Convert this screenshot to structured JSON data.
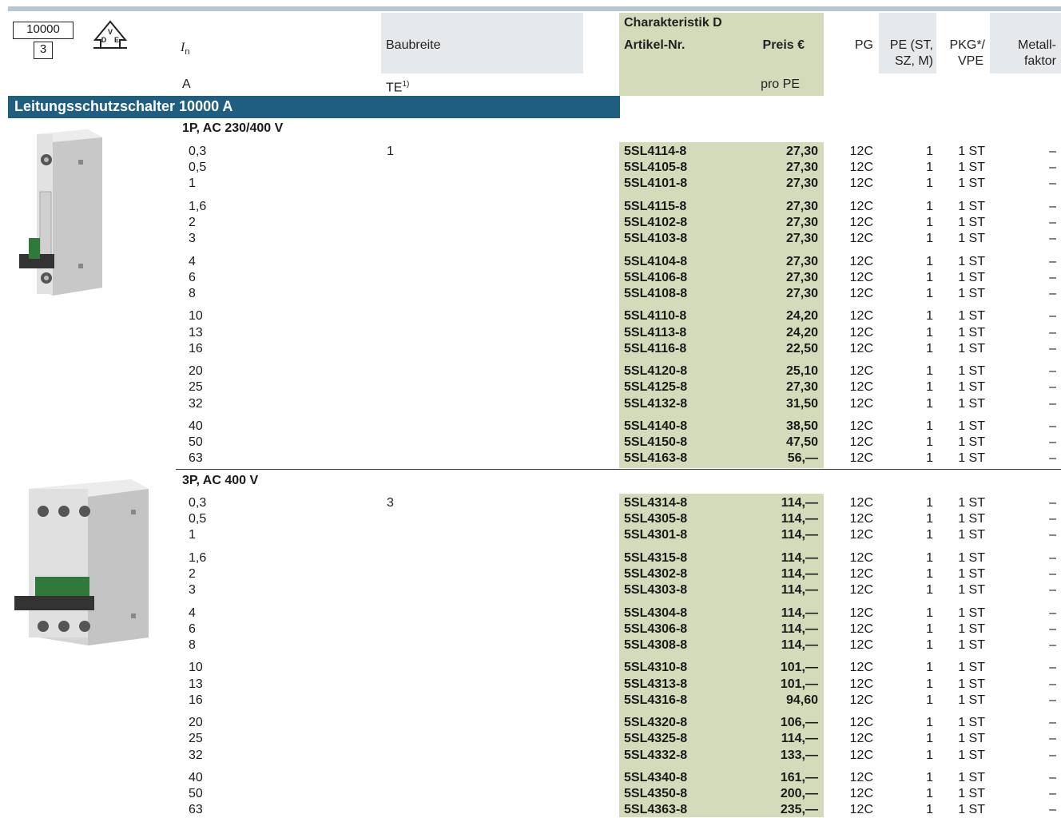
{
  "header": {
    "box_top": "10000",
    "box_bottom": "3",
    "vde_logo": "VDE",
    "col_in_label": "I",
    "col_in_sub": "n",
    "col_in_unit": "A",
    "col_width_label": "Baubreite",
    "col_width_unit": "TE",
    "col_width_sup": "1)",
    "characteristic": "Charakteristik D",
    "col_article": "Artikel-Nr.",
    "col_price": "Preis €",
    "col_price_unit": "pro PE",
    "col_pg": "PG",
    "col_pe_line1": "PE (ST,",
    "col_pe_line2": "SZ, M)",
    "col_pkg_line1": "PKG*/",
    "col_pkg_line2": "VPE",
    "col_mf_line1": "Metall-",
    "col_mf_line2": "faktor"
  },
  "section_title": "Leitungsschutzschalter 10000 A",
  "groups": [
    {
      "title": "1P, AC 230/400 V",
      "image_icon": "breaker-1p-icon",
      "te": "1",
      "rows": [
        {
          "in": "0,3",
          "art": "5SL4114-8",
          "price": "27,30",
          "pg": "12C",
          "pe": "1",
          "pkg": "1 ST",
          "mf": "–"
        },
        {
          "in": "0,5",
          "art": "5SL4105-8",
          "price": "27,30",
          "pg": "12C",
          "pe": "1",
          "pkg": "1 ST",
          "mf": "–"
        },
        {
          "in": "1",
          "art": "5SL4101-8",
          "price": "27,30",
          "pg": "12C",
          "pe": "1",
          "pkg": "1 ST",
          "mf": "–"
        },
        {
          "in": "1,6",
          "art": "5SL4115-8",
          "price": "27,30",
          "pg": "12C",
          "pe": "1",
          "pkg": "1 ST",
          "mf": "–"
        },
        {
          "in": "2",
          "art": "5SL4102-8",
          "price": "27,30",
          "pg": "12C",
          "pe": "1",
          "pkg": "1 ST",
          "mf": "–"
        },
        {
          "in": "3",
          "art": "5SL4103-8",
          "price": "27,30",
          "pg": "12C",
          "pe": "1",
          "pkg": "1 ST",
          "mf": "–"
        },
        {
          "in": "4",
          "art": "5SL4104-8",
          "price": "27,30",
          "pg": "12C",
          "pe": "1",
          "pkg": "1 ST",
          "mf": "–"
        },
        {
          "in": "6",
          "art": "5SL4106-8",
          "price": "27,30",
          "pg": "12C",
          "pe": "1",
          "pkg": "1 ST",
          "mf": "–"
        },
        {
          "in": "8",
          "art": "5SL4108-8",
          "price": "27,30",
          "pg": "12C",
          "pe": "1",
          "pkg": "1 ST",
          "mf": "–"
        },
        {
          "in": "10",
          "art": "5SL4110-8",
          "price": "24,20",
          "pg": "12C",
          "pe": "1",
          "pkg": "1 ST",
          "mf": "–"
        },
        {
          "in": "13",
          "art": "5SL4113-8",
          "price": "24,20",
          "pg": "12C",
          "pe": "1",
          "pkg": "1 ST",
          "mf": "–"
        },
        {
          "in": "16",
          "art": "5SL4116-8",
          "price": "22,50",
          "pg": "12C",
          "pe": "1",
          "pkg": "1 ST",
          "mf": "–"
        },
        {
          "in": "20",
          "art": "5SL4120-8",
          "price": "25,10",
          "pg": "12C",
          "pe": "1",
          "pkg": "1 ST",
          "mf": "–"
        },
        {
          "in": "25",
          "art": "5SL4125-8",
          "price": "27,30",
          "pg": "12C",
          "pe": "1",
          "pkg": "1 ST",
          "mf": "–"
        },
        {
          "in": "32",
          "art": "5SL4132-8",
          "price": "31,50",
          "pg": "12C",
          "pe": "1",
          "pkg": "1 ST",
          "mf": "–"
        },
        {
          "in": "40",
          "art": "5SL4140-8",
          "price": "38,50",
          "pg": "12C",
          "pe": "1",
          "pkg": "1 ST",
          "mf": "–"
        },
        {
          "in": "50",
          "art": "5SL4150-8",
          "price": "47,50",
          "pg": "12C",
          "pe": "1",
          "pkg": "1 ST",
          "mf": "–"
        },
        {
          "in": "63",
          "art": "5SL4163-8",
          "price": "56,—",
          "pg": "12C",
          "pe": "1",
          "pkg": "1 ST",
          "mf": "–"
        }
      ]
    },
    {
      "title": "3P, AC 400 V",
      "image_icon": "breaker-3p-icon",
      "te": "3",
      "rows": [
        {
          "in": "0,3",
          "art": "5SL4314-8",
          "price": "114,—",
          "pg": "12C",
          "pe": "1",
          "pkg": "1 ST",
          "mf": "–"
        },
        {
          "in": "0,5",
          "art": "5SL4305-8",
          "price": "114,—",
          "pg": "12C",
          "pe": "1",
          "pkg": "1 ST",
          "mf": "–"
        },
        {
          "in": "1",
          "art": "5SL4301-8",
          "price": "114,—",
          "pg": "12C",
          "pe": "1",
          "pkg": "1 ST",
          "mf": "–"
        },
        {
          "in": "1,6",
          "art": "5SL4315-8",
          "price": "114,—",
          "pg": "12C",
          "pe": "1",
          "pkg": "1 ST",
          "mf": "–"
        },
        {
          "in": "2",
          "art": "5SL4302-8",
          "price": "114,—",
          "pg": "12C",
          "pe": "1",
          "pkg": "1 ST",
          "mf": "–"
        },
        {
          "in": "3",
          "art": "5SL4303-8",
          "price": "114,—",
          "pg": "12C",
          "pe": "1",
          "pkg": "1 ST",
          "mf": "–"
        },
        {
          "in": "4",
          "art": "5SL4304-8",
          "price": "114,—",
          "pg": "12C",
          "pe": "1",
          "pkg": "1 ST",
          "mf": "–"
        },
        {
          "in": "6",
          "art": "5SL4306-8",
          "price": "114,—",
          "pg": "12C",
          "pe": "1",
          "pkg": "1 ST",
          "mf": "–"
        },
        {
          "in": "8",
          "art": "5SL4308-8",
          "price": "114,—",
          "pg": "12C",
          "pe": "1",
          "pkg": "1 ST",
          "mf": "–"
        },
        {
          "in": "10",
          "art": "5SL4310-8",
          "price": "101,—",
          "pg": "12C",
          "pe": "1",
          "pkg": "1 ST",
          "mf": "–"
        },
        {
          "in": "13",
          "art": "5SL4313-8",
          "price": "101,—",
          "pg": "12C",
          "pe": "1",
          "pkg": "1 ST",
          "mf": "–"
        },
        {
          "in": "16",
          "art": "5SL4316-8",
          "price": "94,60",
          "pg": "12C",
          "pe": "1",
          "pkg": "1 ST",
          "mf": "–"
        },
        {
          "in": "20",
          "art": "5SL4320-8",
          "price": "106,—",
          "pg": "12C",
          "pe": "1",
          "pkg": "1 ST",
          "mf": "–"
        },
        {
          "in": "25",
          "art": "5SL4325-8",
          "price": "114,—",
          "pg": "12C",
          "pe": "1",
          "pkg": "1 ST",
          "mf": "–"
        },
        {
          "in": "32",
          "art": "5SL4332-8",
          "price": "133,—",
          "pg": "12C",
          "pe": "1",
          "pkg": "1 ST",
          "mf": "–"
        },
        {
          "in": "40",
          "art": "5SL4340-8",
          "price": "161,—",
          "pg": "12C",
          "pe": "1",
          "pkg": "1 ST",
          "mf": "–"
        },
        {
          "in": "50",
          "art": "5SL4350-8",
          "price": "200,—",
          "pg": "12C",
          "pe": "1",
          "pkg": "1 ST",
          "mf": "–"
        },
        {
          "in": "63",
          "art": "5SL4363-8",
          "price": "235,—",
          "pg": "12C",
          "pe": "1",
          "pkg": "1 ST",
          "mf": "–"
        }
      ]
    }
  ]
}
